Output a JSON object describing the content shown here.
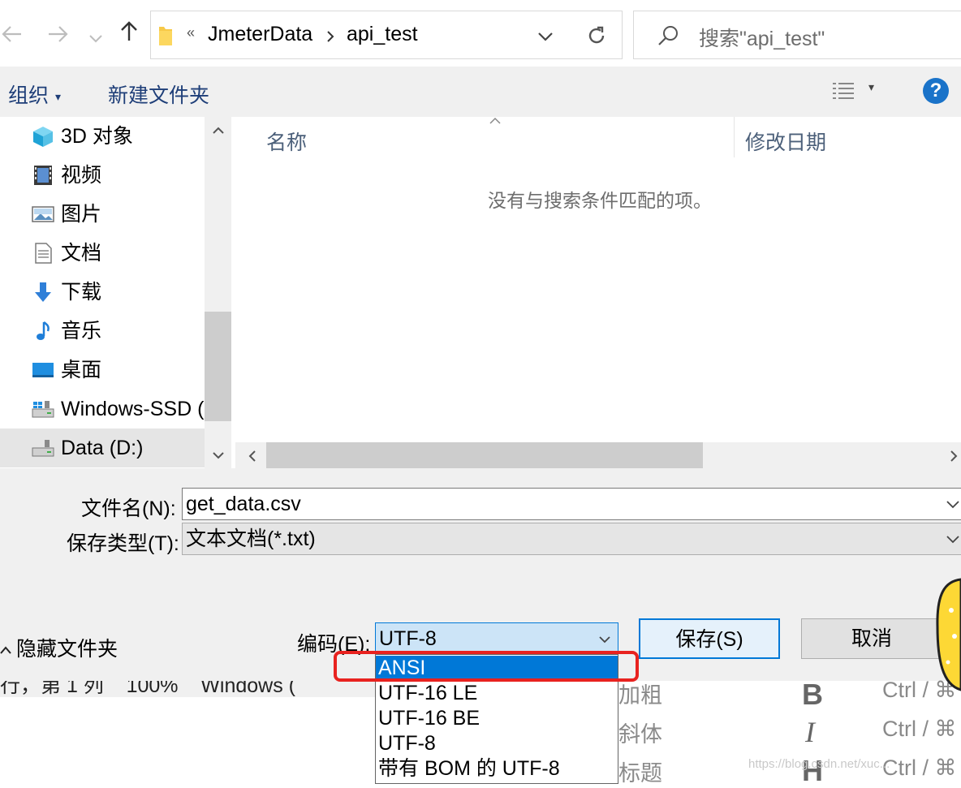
{
  "nav": {
    "back_icon": "arrow-left-icon",
    "forward_icon": "arrow-right-icon",
    "recent_icon": "chevron-down-icon",
    "up_icon": "arrow-up-icon",
    "breadcrumb_overflow": "«",
    "breadcrumb": [
      "JmeterData",
      "api_test"
    ],
    "refresh_icon": "refresh-icon",
    "search_placeholder": "搜索\"api_test\""
  },
  "toolbar": {
    "organize_label": "组织",
    "new_folder_label": "新建文件夹",
    "help_label": "?"
  },
  "sidebar": {
    "items": [
      {
        "label": "3D 对象",
        "icon": "3d-objects-icon"
      },
      {
        "label": "视频",
        "icon": "videos-icon"
      },
      {
        "label": "图片",
        "icon": "pictures-icon"
      },
      {
        "label": "文档",
        "icon": "documents-icon"
      },
      {
        "label": "下载",
        "icon": "downloads-icon"
      },
      {
        "label": "音乐",
        "icon": "music-icon"
      },
      {
        "label": "桌面",
        "icon": "desktop-icon"
      },
      {
        "label": "Windows-SSD (",
        "icon": "drive-icon"
      },
      {
        "label": "Data (D:)",
        "icon": "drive-icon"
      }
    ],
    "selected_index": 8
  },
  "file_list": {
    "columns": [
      "名称",
      "修改日期"
    ],
    "empty_message": "没有与搜索条件匹配的项。"
  },
  "form": {
    "filename_label": "文件名(N):",
    "filename_value": "get_data.csv",
    "filetype_label": "保存类型(T):",
    "filetype_value": "文本文档(*.txt)",
    "hide_folders_label": "隐藏文件夹",
    "encoding_label": "编码(E):",
    "encoding_value": "UTF-8",
    "save_label": "保存(S)",
    "cancel_label": "取消"
  },
  "encoding_dropdown": {
    "options": [
      "ANSI",
      "UTF-16 LE",
      "UTF-16 BE",
      "UTF-8",
      "带有 BOM 的 UTF-8"
    ],
    "highlighted": "ANSI"
  },
  "background": {
    "status_text": "行，第 1 列    100%    Windows (",
    "menu_items": [
      {
        "label": "加粗",
        "glyph": "B",
        "shortcut": "Ctrl / ⌘"
      },
      {
        "label": "斜体",
        "glyph": "I",
        "shortcut": "Ctrl / ⌘"
      },
      {
        "label": "标题",
        "glyph": "H",
        "shortcut": "Ctrl / ⌘"
      }
    ],
    "watermark": "https://blog.csdn.net/xuc..."
  },
  "colors": {
    "accent": "#0078d7",
    "help_blue": "#1a73c9",
    "highlight_red": "#e8221f",
    "sticker_yellow": "#fdd835"
  }
}
